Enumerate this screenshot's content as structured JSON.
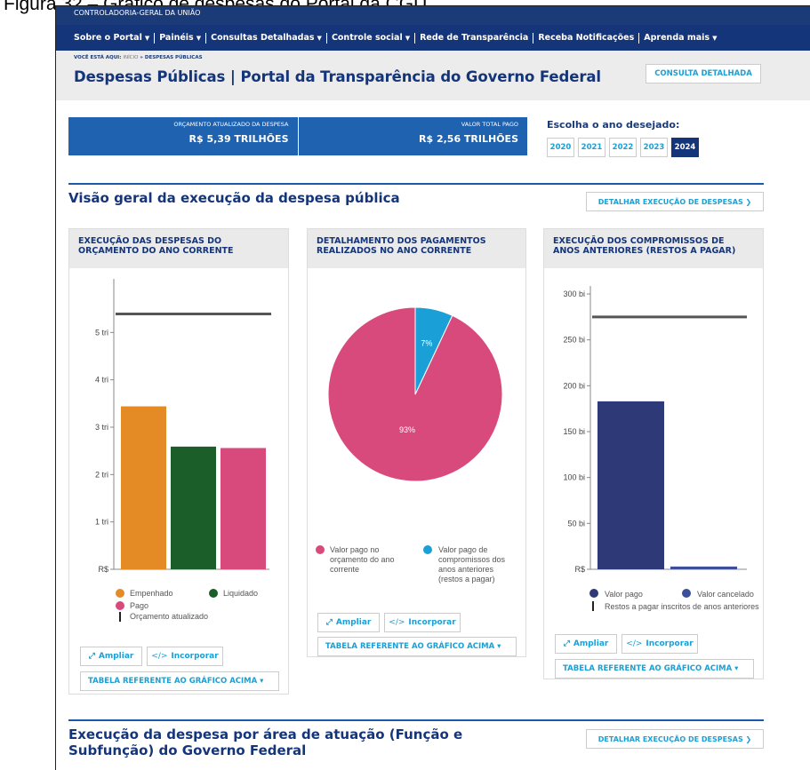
{
  "document": {
    "caption": "Figura 32 – Gráfico de despesas do Portal da CGU"
  },
  "header": {
    "org": "CONTROLADORIA-GERAL DA UNIÃO",
    "nav": [
      "Sobre o Portal",
      "Painéis",
      "Consultas Detalhadas",
      "Controle social",
      "Rede de Transparência",
      "Receba Notificações",
      "Aprenda mais"
    ],
    "breadcrumb_prefix": "VOCÊ ESTÁ AQUI:",
    "breadcrumb_home": "INÍCIO",
    "breadcrumb_current": "» DESPESAS PÚBLICAS",
    "title": "Despesas Públicas | Portal da Transparência do Governo Federal",
    "consulta_button": "CONSULTA DETALHADA"
  },
  "stats": [
    {
      "label": "ORÇAMENTO ATUALIZADO DA DESPESA",
      "value": "R$ 5,39 TRILHÕES"
    },
    {
      "label": "VALOR TOTAL PAGO",
      "value": "R$ 2,56 TRILHÕES"
    }
  ],
  "year_selector": {
    "label": "Escolha o ano desejado:",
    "years": [
      "2020",
      "2021",
      "2022",
      "2023",
      "2024"
    ],
    "selected": "2024"
  },
  "section1": {
    "title": "Visão geral da execução da despesa pública",
    "button": "DETALHAR EXECUÇÃO DE DESPESAS ❯"
  },
  "section2": {
    "title_line1": "Execução da despesa por área de atuação (Função e",
    "title_line2": "Subfunção) do Governo Federal",
    "button": "DETALHAR EXECUÇÃO DE DESPESAS ❯"
  },
  "actions": {
    "ampliar": "Ampliar",
    "incorporar": "Incorporar",
    "tabela": "TABELA REFERENTE AO GRÁFICO ACIMA ▾"
  },
  "icons": {
    "ampliar": "expand-arrow-icon",
    "incorporar": "code-brackets-icon"
  },
  "colors": {
    "navy": "#15357a",
    "accent": "#1aa0d6",
    "orange": "#e58b26",
    "green": "#1b5e2a",
    "pink": "#d94a7c",
    "navy_bar": "#2e3a78",
    "blue_bar": "#3c4f9a",
    "cyan": "#1aa0d6"
  },
  "charts": {
    "card1": {
      "title_line1": "EXECUÇÃO DAS DESPESAS DO",
      "title_line2": "ORÇAMENTO DO ANO CORRENTE",
      "legend": [
        "Empenhado",
        "Liquidado",
        "Pago",
        "Orçamento atualizado"
      ]
    },
    "card2": {
      "title_line1": "DETALHAMENTO DOS PAGAMENTOS",
      "title_line2": "REALIZADOS NO ANO CORRENTE",
      "legend": [
        [
          "Valor pago no",
          "orçamento do ano",
          "corrente"
        ],
        [
          "Valor pago de",
          "compromissos dos",
          "anos anteriores",
          "(restos a pagar)"
        ]
      ]
    },
    "card3": {
      "title_line1": "EXECUÇÃO DOS COMPROMISSOS DE",
      "title_line2": "ANOS ANTERIORES (RESTOS A PAGAR)",
      "legend": [
        "Valor pago",
        "Valor cancelado",
        "Restos a pagar inscritos de anos anteriores"
      ]
    }
  },
  "chart_data": [
    {
      "type": "bar",
      "title": "EXECUÇÃO DAS DESPESAS DO ORÇAMENTO DO ANO CORRENTE",
      "categories": [
        "Empenhado",
        "Liquidado",
        "Pago"
      ],
      "values": [
        3.44,
        2.59,
        2.56
      ],
      "reference_line": {
        "name": "Orçamento atualizado",
        "value": 5.39
      },
      "ylim": [
        0,
        6
      ],
      "yticks": [
        "R$",
        "1 tri",
        "2 tri",
        "3 tri",
        "4 tri",
        "5 tri"
      ],
      "ytick_values": [
        0,
        1,
        2,
        3,
        4,
        5
      ],
      "unit": "tri"
    },
    {
      "type": "pie",
      "title": "DETALHAMENTO DOS PAGAMENTOS REALIZADOS NO ANO CORRENTE",
      "labels": [
        "Valor pago no orçamento do ano corrente",
        "Valor pago de compromissos dos anos anteriores (restos a pagar)"
      ],
      "values": [
        93,
        7
      ],
      "data_labels": [
        "93%",
        "7%"
      ]
    },
    {
      "type": "bar",
      "title": "EXECUÇÃO DOS COMPROMISSOS DE ANOS ANTERIORES (RESTOS A PAGAR)",
      "categories": [
        "Valor pago",
        "Valor cancelado"
      ],
      "values": [
        183,
        3
      ],
      "reference_line": {
        "name": "Restos a pagar inscritos de anos anteriores",
        "value": 275
      },
      "ylim": [
        0,
        300
      ],
      "yticks": [
        "R$",
        "50 bi",
        "100 bi",
        "150 bi",
        "200 bi",
        "250 bi",
        "300 bi"
      ],
      "ytick_values": [
        0,
        50,
        100,
        150,
        200,
        250,
        300
      ],
      "unit": "bi"
    }
  ]
}
